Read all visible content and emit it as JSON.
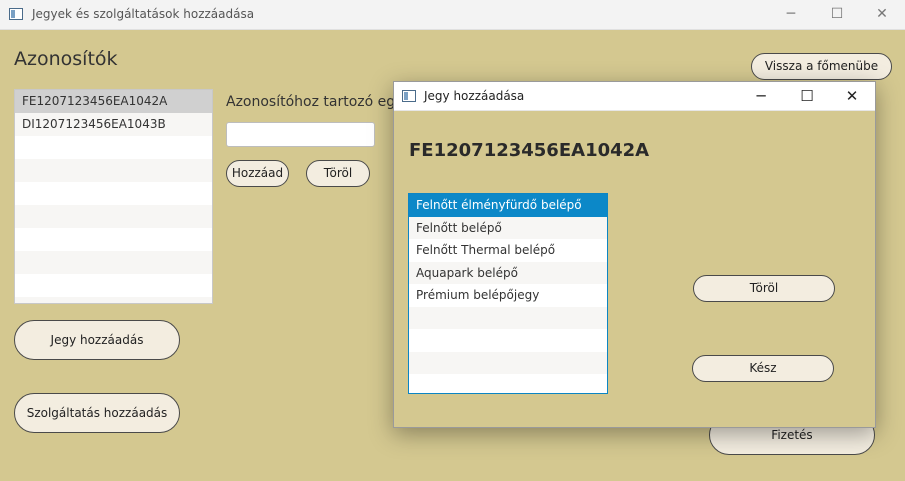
{
  "window": {
    "title": "Jegyek és szolgáltatások hozzáadása",
    "minimize_glyph": "─",
    "maximize_glyph": "☐",
    "close_glyph": "✕"
  },
  "main": {
    "section_title": "Azonosítók",
    "ids": [
      {
        "label": "FE1207123456EA1042A",
        "selected": true
      },
      {
        "label": "DI1207123456EA1043B",
        "selected": false
      }
    ],
    "id_label": "Azonosítóhoz tartozó eg",
    "id_input_value": "",
    "add_button": "Hozzáad",
    "delete_button": "Töröl",
    "add_ticket_button": "Jegy hozzáadás",
    "add_service_button": "Szolgáltatás hozzáadás",
    "back_button": "Vissza a főmenübe",
    "pay_button": "Fizetés"
  },
  "dialog": {
    "title": "Jegy hozzáadása",
    "minimize_glyph": "─",
    "maximize_glyph": "☐",
    "close_glyph": "✕",
    "ticket_id": "FE1207123456EA1042A",
    "tickets": [
      {
        "label": "Felnőtt élményfürdő belépő",
        "selected": true
      },
      {
        "label": "Felnőtt belépő",
        "selected": false
      },
      {
        "label": "Felnőtt Thermal belépő",
        "selected": false
      },
      {
        "label": "Aquapark belépő",
        "selected": false
      },
      {
        "label": "Prémium belépőjegy",
        "selected": false
      }
    ],
    "delete_button": "Töröl",
    "done_button": "Kész"
  },
  "colors": {
    "background": "#d4c890",
    "selection": "#0c88c8",
    "button_fill": "#f3ede0"
  }
}
